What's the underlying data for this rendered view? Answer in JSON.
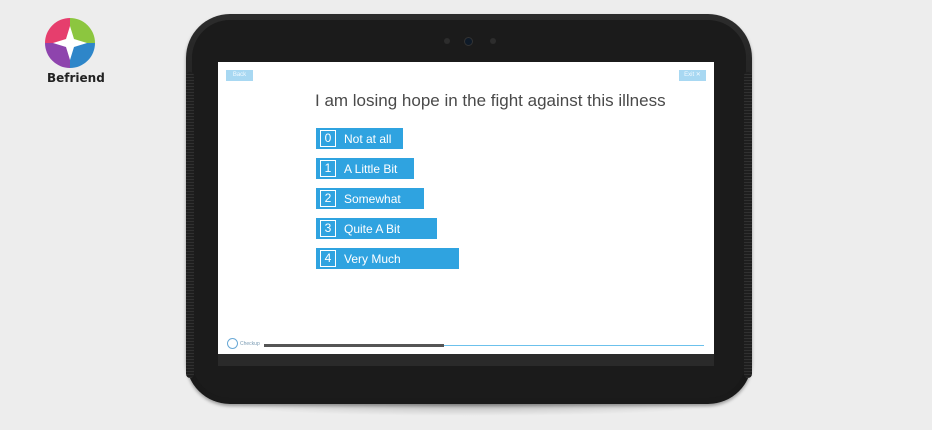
{
  "brand": {
    "name": "Befriend"
  },
  "survey": {
    "back_label": "Back",
    "exit_label": "Exit ✕",
    "question": "I am losing hope in the fight against this illness",
    "options": [
      {
        "number": "0",
        "label": "Not at all"
      },
      {
        "number": "1",
        "label": "A Little Bit"
      },
      {
        "number": "2",
        "label": "Somewhat"
      },
      {
        "number": "3",
        "label": "Quite A Bit"
      },
      {
        "number": "4",
        "label": "Very Much"
      }
    ],
    "footer_brand": "Checkup",
    "progress_fraction": 0.41
  },
  "colors": {
    "accent": "#2fa3e0",
    "button_light": "#a8d8f2",
    "device_body": "#1b1b1b"
  }
}
